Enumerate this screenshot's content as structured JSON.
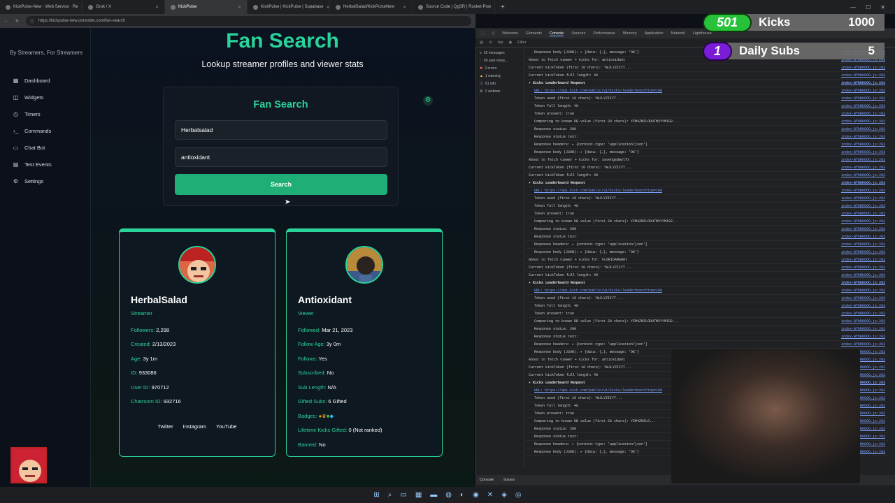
{
  "browser": {
    "tabs": [
      {
        "title": "KickPulse-New · Web Service · Re",
        "active": false
      },
      {
        "title": "Grok / X",
        "active": false
      },
      {
        "title": "KickPulse",
        "active": true
      },
      {
        "title": "KickPulse | KickPulse | Supabase",
        "active": false
      },
      {
        "title": "HerbalSalad/KickPulseNew",
        "active": false
      },
      {
        "title": "Source Code | QgSR | Rocket Pow",
        "active": false
      }
    ],
    "url": "https://kickpulse-new.onrender.com/fan-search"
  },
  "sidebar": {
    "tagline": "By Streamers, For Streamers",
    "items": [
      {
        "label": "Dashboard",
        "icon": "grid-icon"
      },
      {
        "label": "Widgets",
        "icon": "widgets-icon"
      },
      {
        "label": "Timers",
        "icon": "clock-icon"
      },
      {
        "label": "Commands",
        "icon": "terminal-icon"
      },
      {
        "label": "Chat Bot",
        "icon": "chat-icon"
      },
      {
        "label": "Test Events",
        "icon": "calendar-icon"
      },
      {
        "label": "Settings",
        "icon": "gear-icon"
      }
    ]
  },
  "page": {
    "title": "Fan Search",
    "subtitle": "Lookup streamer profiles and viewer stats"
  },
  "search": {
    "card_title": "Fan Search",
    "streamer_value": "Herbalsalad",
    "viewer_value": "antioxidant",
    "button_label": "Search"
  },
  "streamer_card": {
    "name": "HerbalSalad",
    "role": "Streamer",
    "rows": [
      {
        "k": "Followers:",
        "v": "2,298"
      },
      {
        "k": "Created:",
        "v": "2/13/2023"
      },
      {
        "k": "Age:",
        "v": "3y 1m"
      },
      {
        "k": "ID:",
        "v": "933086"
      },
      {
        "k": "User ID:",
        "v": "970712"
      },
      {
        "k": "Chatroom ID:",
        "v": "932716"
      }
    ],
    "socials": [
      "Twitter",
      "Instagram",
      "YouTube"
    ]
  },
  "viewer_card": {
    "name": "Antioxidant",
    "role": "Viewer",
    "rows": [
      {
        "k": "Followed:",
        "v": "Mar 21, 2023"
      },
      {
        "k": "Follow Age:",
        "v": "3y 0m"
      },
      {
        "k": "Follows:",
        "v": "Yes"
      },
      {
        "k": "Subscribed:",
        "v": "No"
      },
      {
        "k": "Sub Length:",
        "v": "N/A"
      },
      {
        "k": "Gifted Subs:",
        "v": "6 Gifted"
      },
      {
        "k": "Badges:",
        "v": ""
      },
      {
        "k": "Lifetime Kicks Gifted:",
        "v": "0 (Not ranked)"
      },
      {
        "k": "Banned:",
        "v": "No"
      }
    ]
  },
  "devtools": {
    "tabs": [
      "Welcome",
      "Elements",
      "Console",
      "Sources",
      "Performance",
      "Memory",
      "Application",
      "Network",
      "Lighthouse"
    ],
    "active_tab": "Console",
    "context": "top",
    "filter_placeholder": "Filter",
    "sidebar": [
      "62 messages",
      "60 user mess...",
      "2 errors",
      "1 warning",
      "61 info",
      "1 verbose"
    ],
    "source_link": "index-BfbRKOOO.js:203",
    "bottom_tabs": [
      "Console",
      "Issues"
    ],
    "logs": [
      "Response body (JSON): ▸ {data: {…}, message: 'OK'}",
      "About to fetch viewer + kicks for: antioxidant",
      "Current kickToken (first 10 chars): YWJLYZIIYT...",
      "Current kickToken full length: 48",
      "▾ Kicks Leaderboard Request",
      "URL: https://api.kick.com/public/v1/kicks/leaderboard?top=100",
      "Token used (first 10 chars): YWJLYZIIYT...",
      "Token full length: 48",
      "Token present: true",
      "Comparing to known DB value (first 20 chars): YZM4ZMZLODUTM2YYMI02...",
      "Response status: 200",
      "Response status text:",
      "Response headers: ▸ {content-type: 'application/json'}",
      "Response body (JSON): ▸ {data: {…}, message: 'OK'}",
      "About to fetch viewer + kicks for: xavengedwolfx",
      "Current kickToken (first 10 chars): YWJLYZIIYT...",
      "Current kickToken full length: 48",
      "▾ Kicks Leaderboard Request",
      "URL: https://api.kick.com/public/v1/kicks/leaderboard?top=100",
      "Token used (first 10 chars): YWJLYZIIYT...",
      "Token full length: 48",
      "Token present: true",
      "Comparing to known DB value (first 20 chars): YZM4ZMZLODUTM2YYMI02...",
      "Response status: 200",
      "Response status text:",
      "Response headers: ▸ {content-type: 'application/json'}",
      "Response body (JSON): ▸ {data: {…}, message: 'OK'}",
      "About to fetch viewer + kicks for: FLORIDAMAN07",
      "Current kickToken (first 10 chars): YWJLYZIIYT...",
      "Current kickToken full length: 48",
      "▾ Kicks Leaderboard Request",
      "URL: https://api.kick.com/public/v1/kicks/leaderboard?top=100",
      "Token used (first 10 chars): YWJLYZIIYT...",
      "Token full length: 48",
      "Token present: true",
      "Comparing to known DB value (first 20 chars): YZM4ZMZLODUTM2YYMI02...",
      "Response status: 200",
      "Response status text:",
      "Response headers: ▸ {content-type: 'application/json'}",
      "Response body (JSON): ▸ {data: {…}, message: 'OK'}",
      "About to fetch viewer + kicks for: antioxidant",
      "Current kickToken (first 10 chars): YWJLYZIIYT...",
      "Current kickToken full length: 48",
      "▾ Kicks Leaderboard Request",
      "URL: https://api.kick.com/public/v1/kicks/leaderboard?top=100",
      "Token used (first 10 chars): YWJLYZIIYT...",
      "Token full length: 48",
      "Token present: true",
      "Comparing to known DB value (first 20 chars): YZM4ZMZLO...",
      "Response status: 200",
      "Response status text:",
      "Response headers: ▸ {content-type: 'application/json'}",
      "Response body (JSON): ▸ {data: {…}, message: 'OK'}"
    ]
  },
  "overlay": {
    "kicks_current": "501",
    "kicks_label": "Kicks",
    "kicks_goal": "1000",
    "subs_current": "1",
    "subs_label": "Daily Subs",
    "subs_goal": "5"
  },
  "colors": {
    "accent": "#2ad39a",
    "button": "#1fae75",
    "kicks_green": "#27c23a",
    "subs_purple": "#7a1dd6"
  }
}
